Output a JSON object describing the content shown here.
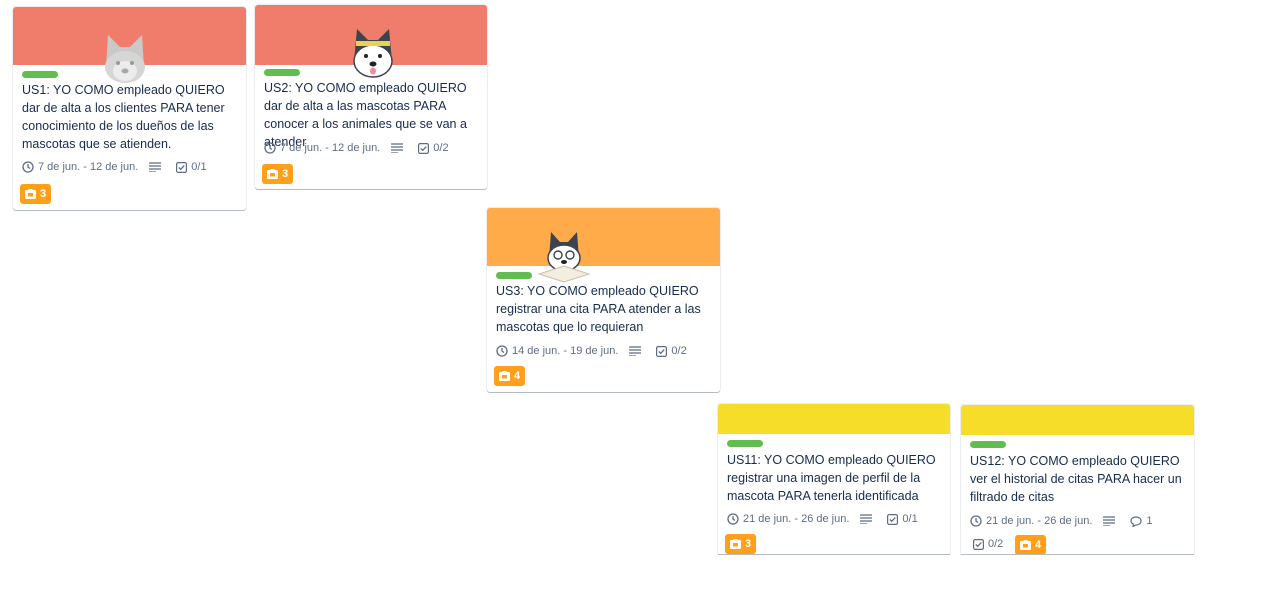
{
  "colors": {
    "cover_red": "#f07d6b",
    "cover_orange": "#ffab4a",
    "cover_yellow": "#f5dd29",
    "label_green": "#61bd4f",
    "points_orange": "#ff9f1a",
    "meta_gray": "#5e6c84"
  },
  "cards": [
    {
      "id": "us1",
      "cover_color": "#f07d6b",
      "mascot": "husky-mascot-ghost",
      "title": "US1: YO COMO empleado QUIERO dar de alta a los clientes PARA tener conocimiento de los dueños de las mascotas que se atienden.",
      "dates": "7 de jun. - 12 de jun.",
      "checklist": "0/1",
      "comments": "",
      "points": "3"
    },
    {
      "id": "us2",
      "cover_color": "#f07d6b",
      "mascot": "husky-mascot-headband",
      "title": "US2: YO COMO empleado QUIERO dar de alta a las mascotas PARA conocer a los animales que se van a atender",
      "dates": "7 de jun. - 12 de jun.",
      "checklist": "0/2",
      "comments": "",
      "points": "3"
    },
    {
      "id": "us3",
      "cover_color": "#ffab4a",
      "mascot": "husky-mascot-reading",
      "title": "US3: YO COMO empleado QUIERO registrar una cita PARA atender a las mascotas que lo requieran",
      "dates": "14 de jun. - 19 de jun.",
      "checklist": "0/2",
      "comments": "",
      "points": "4"
    },
    {
      "id": "us11",
      "cover_color": "#f5dd29",
      "mascot": "",
      "title": "US11: YO COMO empleado QUIERO registrar una imagen de perfil de la mascota PARA tenerla identificada",
      "dates": "21 de jun. - 26 de jun.",
      "checklist": "0/1",
      "comments": "",
      "points": "3"
    },
    {
      "id": "us12",
      "cover_color": "#f5dd29",
      "mascot": "",
      "title": "US12: YO COMO empleado QUIERO ver el historial de citas PARA hacer un filtrado de citas",
      "dates": "21 de jun. - 26 de jun.",
      "checklist": "0/2",
      "comments": "1",
      "points": "4"
    }
  ]
}
